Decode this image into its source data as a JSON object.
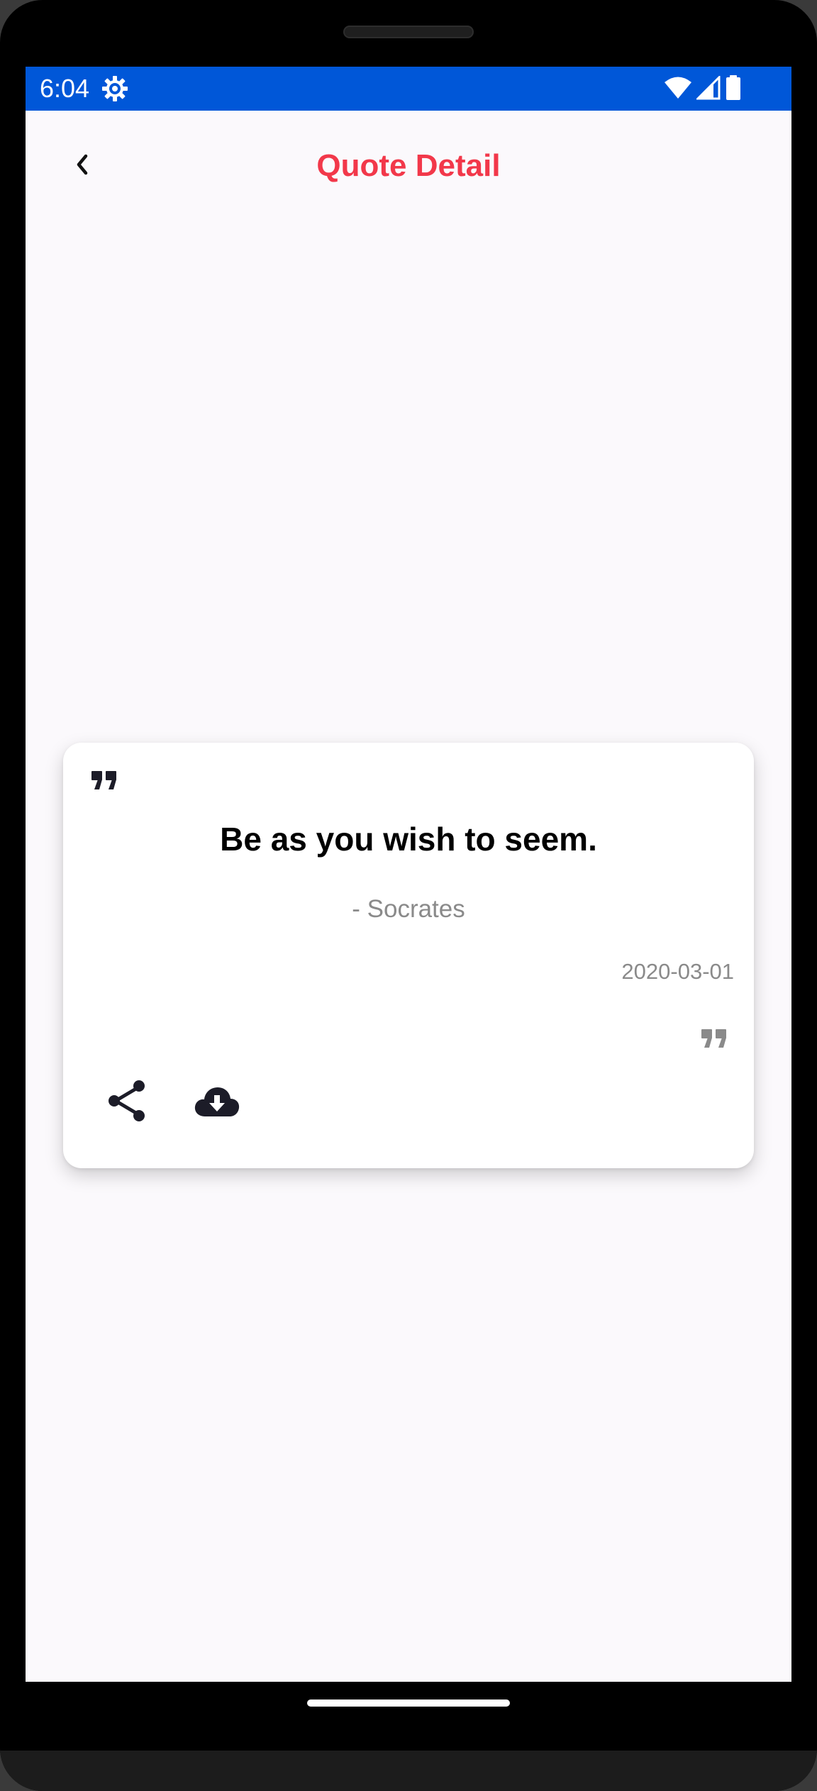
{
  "status_bar": {
    "time": "6:04",
    "background": "#0057d8",
    "icons": [
      "gear-icon",
      "wifi-icon",
      "cell-signal-icon",
      "battery-icon"
    ]
  },
  "header": {
    "title": "Quote Detail",
    "title_color": "#f2384a",
    "back_icon": "chevron-left-icon"
  },
  "quote": {
    "text": "Be as you wish to seem.",
    "author": "- Socrates",
    "date": "2020-03-01"
  },
  "actions": {
    "share_icon": "share-icon",
    "download_icon": "cloud-download-icon"
  }
}
